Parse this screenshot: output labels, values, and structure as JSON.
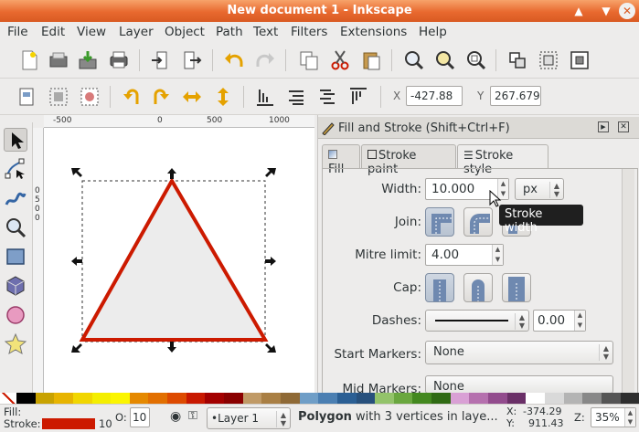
{
  "window": {
    "title": "New document 1 - Inkscape"
  },
  "menu": [
    "File",
    "Edit",
    "View",
    "Layer",
    "Object",
    "Path",
    "Text",
    "Filters",
    "Extensions",
    "Help"
  ],
  "toolcontrols": {
    "x_label": "X",
    "x_value": "-427.88",
    "y_label": "Y",
    "y_value": "267.679"
  },
  "rulers": {
    "h_ticks": [
      "-500",
      "0",
      "500",
      "1000"
    ],
    "v_ticks": [
      "0",
      "5",
      "0",
      "0"
    ]
  },
  "panel": {
    "title": "Fill and Stroke (Shift+Ctrl+F)",
    "tabs": [
      "Fill",
      "Stroke paint",
      "Stroke style"
    ],
    "width_label": "Width:",
    "width_value": "10.000",
    "unit": "px",
    "join_label": "Join:",
    "mitre_label": "Mitre limit:",
    "mitre_value": "4.00",
    "cap_label": "Cap:",
    "dashes_label": "Dashes:",
    "dashes_value": "0.00",
    "start_markers_label": "Start Markers:",
    "start_markers_value": "None",
    "mid_markers_label": "Mid Markers:",
    "mid_markers_value": "None"
  },
  "tooltip": "Stroke width",
  "status": {
    "fill_label": "Fill:",
    "stroke_label": "Stroke:",
    "stroke_color": "#cc1a00",
    "stroke_width": "10",
    "opacity_label": "O:",
    "opacity_value": "10",
    "layer": "•Layer 1",
    "message_bold": "Polygon",
    "message_rest": " with 3 vertices in laye...",
    "cursor_x_label": "X:",
    "cursor_x": "-374.29",
    "cursor_y_label": "Y:",
    "cursor_y": "911.43",
    "zoom_label": "Z:",
    "zoom": "35%"
  },
  "colors": {
    "title_bar": "#e8692f",
    "accent": "#cc1a00",
    "palette": [
      "#000000",
      "#c8a200",
      "#e7b400",
      "#f1d600",
      "#f4ee00",
      "#fbf500",
      "#e58900",
      "#e26f00",
      "#dd4a00",
      "#c81800",
      "#a30000",
      "#8a0000",
      "#c09a66",
      "#a97f44",
      "#8f6a36",
      "#6f9ec7",
      "#4b7fb2",
      "#2b5f94",
      "#27507c",
      "#93c36a",
      "#6aa73f",
      "#43881f",
      "#2f6a13",
      "#d9a0d5",
      "#b570ae",
      "#924b8d",
      "#6a2f67",
      "#ffffff",
      "#d9d9d9",
      "#b4b4b4",
      "#888888",
      "#555555",
      "#2e2e2e"
    ]
  }
}
